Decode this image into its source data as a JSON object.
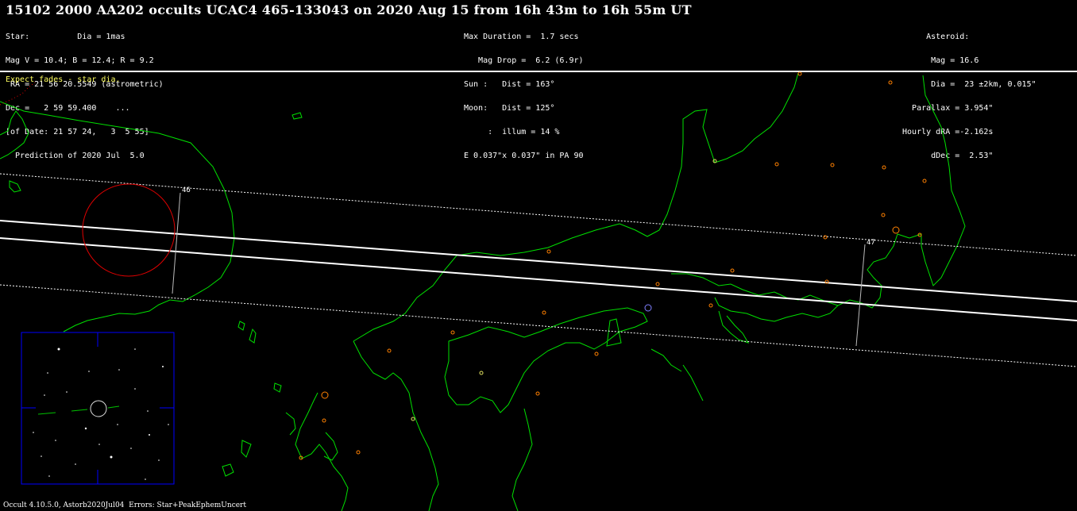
{
  "title": "15102 2000 AA202 occults UCAC4 465-133043 on 2020 Aug 15 from 16h 43m to 16h 55m UT",
  "star_lines": [
    "Star:          Dia = 1mas",
    "Mag V = 10.4; B = 12.4; R = 9.2",
    " RA = 21 56 20.5549 (astrometric)",
    "Dec =   2 59 59.400    ...",
    "[of Date: 21 57 24,   3  5 55]",
    "  Prediction of 2020 Jul  5.0"
  ],
  "event_lines": [
    "Max Duration =  1.7 secs",
    "   Mag Drop =  6.2 (6.9r)",
    "Sun :   Dist = 163°",
    "Moon:   Dist = 125°",
    "     :  illum = 14 %",
    "E 0.037\"x 0.037\" in PA 90"
  ],
  "asteroid_lines": [
    "      Asteroid:",
    "       Mag = 16.6",
    "       Dia =  23 ±2km, 0.015\"",
    "   Parallax = 3.954\"",
    " Hourly dRA =-2.162s",
    "       dDec =  2.53\""
  ],
  "note": "Expect fades - star dia.",
  "time_labels": [
    "46",
    "47"
  ],
  "footer": "Occult 4.10.5.0, Astorb2020Jul04  Errors: Star+PeakEphemUncert",
  "colors": {
    "background": "#000000",
    "coastline": "#00e000",
    "path": "#ffffff",
    "city": "#ff8000",
    "sky_circle": "#e00000",
    "inset_frame": "#0000ff",
    "note": "#ffff60"
  }
}
